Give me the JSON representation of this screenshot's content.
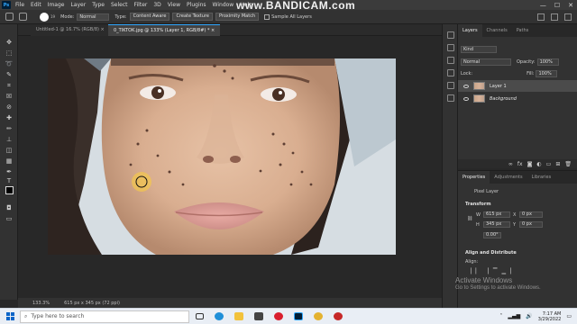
{
  "watermark": "www.BANDICAM.com",
  "menu": [
    "File",
    "Edit",
    "Image",
    "Layer",
    "Type",
    "Select",
    "Filter",
    "3D",
    "View",
    "Plugins",
    "Window",
    "Help"
  ],
  "options": {
    "brush_size": "19",
    "mode_label": "Mode:",
    "mode_value": "Normal",
    "type_label": "Type:",
    "btn_content_aware": "Content Aware",
    "btn_create_texture": "Create Texture",
    "btn_proximity_match": "Proximity Match",
    "sample_all_layers": "Sample All Layers"
  },
  "tabs": [
    {
      "label": "Untitled-1 @ 16.7% (RGB/8) ×"
    },
    {
      "label": "0_TIKTOK.jpg @ 133% (Layer 1, RGB/8#) * ×"
    }
  ],
  "status": {
    "zoom": "133.3%",
    "doc_size": "615 px x 345 px (72 ppi)"
  },
  "layers_panel": {
    "tabs": [
      "Layers",
      "Channels",
      "Paths"
    ],
    "kind_label": "Kind",
    "blend_mode": "Normal",
    "opacity_label": "Opacity:",
    "opacity_value": "100%",
    "lock_label": "Lock:",
    "fill_label": "Fill:",
    "fill_value": "100%",
    "layers": [
      {
        "name": "Layer 1",
        "selected": true
      },
      {
        "name": "Background",
        "selected": false
      }
    ]
  },
  "properties_panel": {
    "tabs": [
      "Properties",
      "Adjustments",
      "Libraries"
    ],
    "layer_type": "Pixel Layer",
    "transform_title": "Transform",
    "w_label": "W",
    "w_value": "615 px",
    "x_label": "X",
    "x_value": "0 px",
    "h_label": "H",
    "h_value": "345 px",
    "y_label": "Y",
    "y_value": "0 px",
    "angle_value": "0.00°",
    "align_title": "Align and Distribute",
    "align_label": "Align:"
  },
  "activation": {
    "title": "Activate Windows",
    "subtitle": "Go to Settings to activate Windows."
  },
  "taskbar": {
    "search_placeholder": "Type here to search",
    "time": "7:17 AM",
    "date": "3/29/2022"
  }
}
